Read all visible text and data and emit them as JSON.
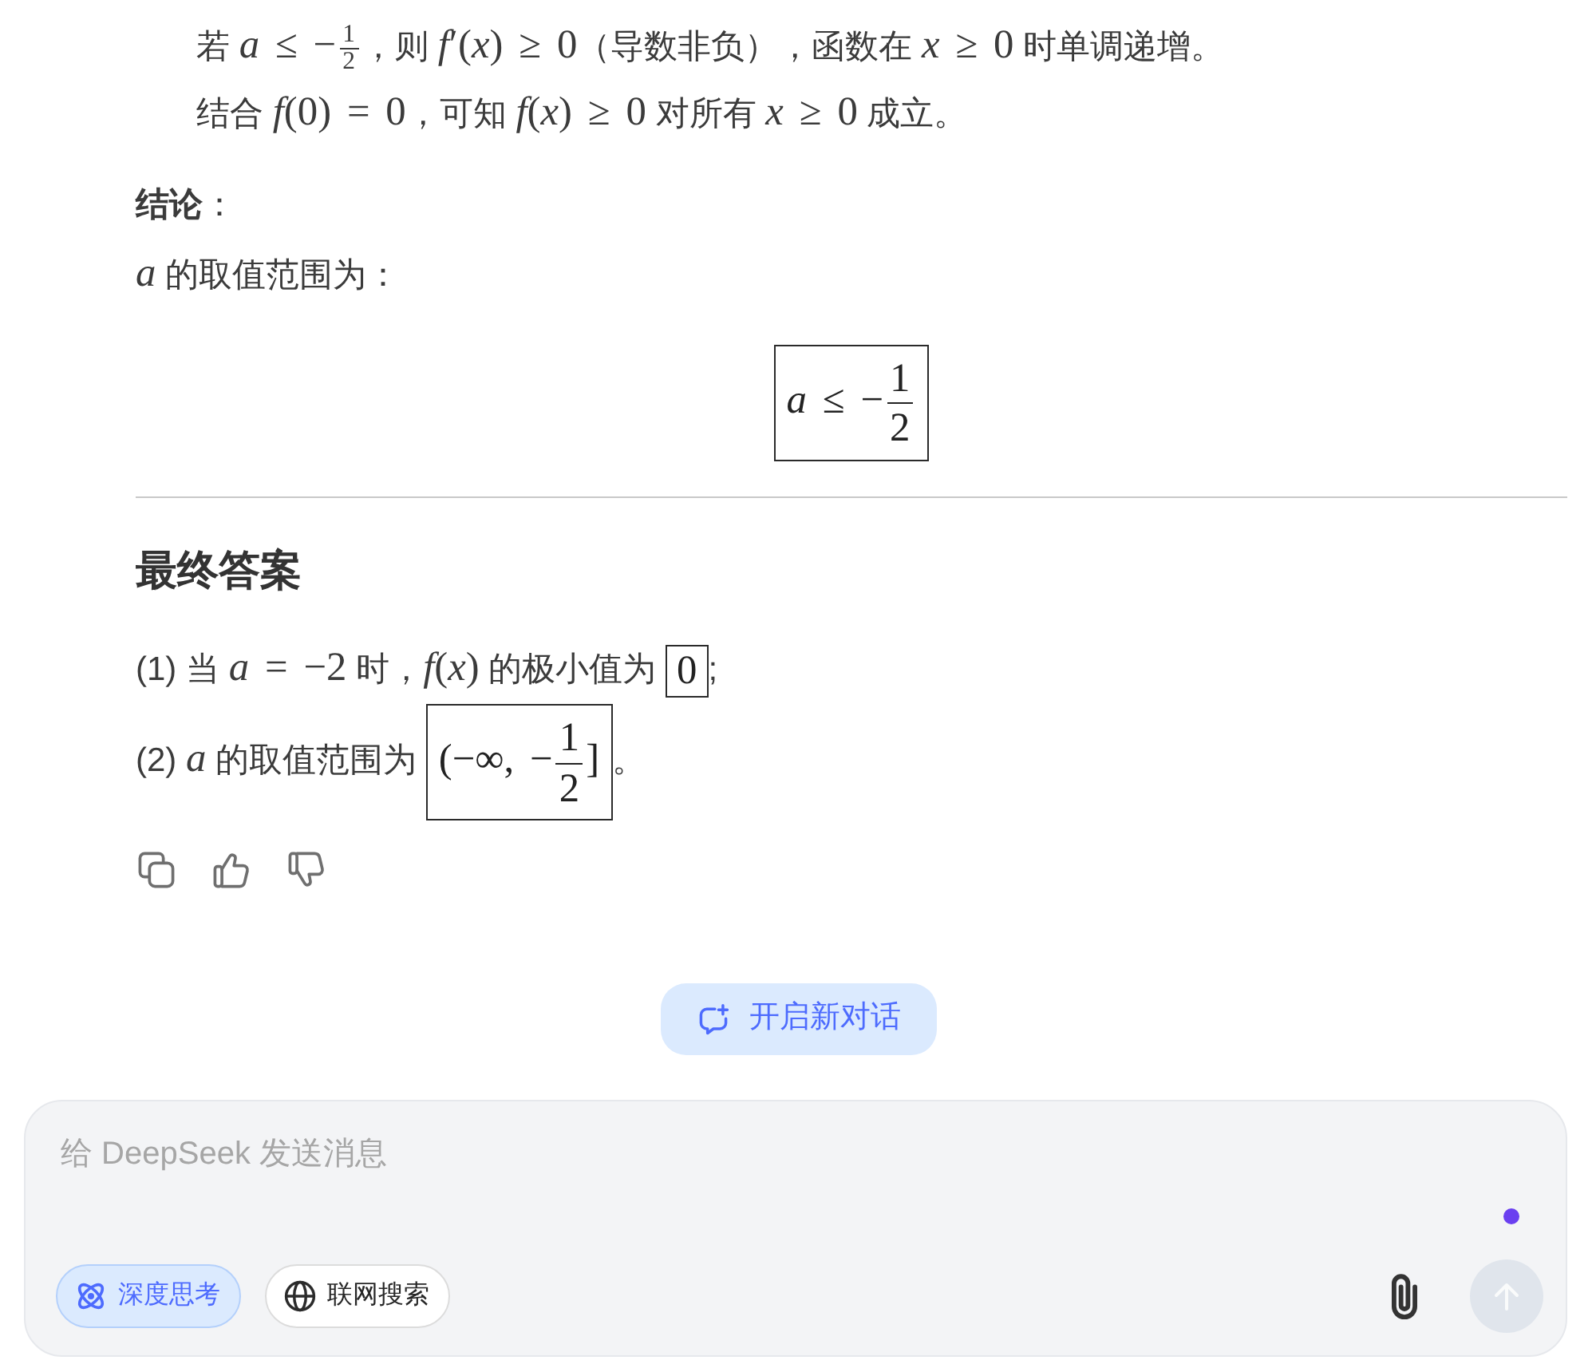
{
  "answer": {
    "steps": [
      {
        "parts": [
          {
            "kind": "text",
            "text": "若 "
          },
          {
            "kind": "math",
            "text": "*a* ≤ −"
          },
          {
            "kind": "frac",
            "num": "1",
            "den": "2"
          },
          {
            "kind": "text",
            "text": "，则 "
          },
          {
            "kind": "math",
            "text": "*f*′(*x*) ≥ 0"
          },
          {
            "kind": "text",
            "text": "（导数非负），函数在 "
          },
          {
            "kind": "math",
            "text": "*x* ≥ 0"
          },
          {
            "kind": "text",
            "text": " 时单调递增。"
          }
        ]
      },
      {
        "parts": [
          {
            "kind": "text",
            "text": "结合 "
          },
          {
            "kind": "math",
            "text": "*f*(0) = 0"
          },
          {
            "kind": "text",
            "text": "，可知 "
          },
          {
            "kind": "math",
            "text": "*f*(*x*) ≥ 0"
          },
          {
            "kind": "text",
            "text": " 对所有 "
          },
          {
            "kind": "math",
            "text": "*x* ≥ 0"
          },
          {
            "kind": "text",
            "text": " 成立。"
          }
        ]
      }
    ],
    "conclusion": {
      "heading": "**结论**：",
      "intro": {
        "parts": [
          {
            "kind": "math",
            "text": "*a*"
          },
          {
            "kind": "text",
            "text": " 的取值范围为："
          }
        ]
      },
      "result": {
        "parts": [
          {
            "kind": "boxed",
            "parts": [
              {
                "kind": "math",
                "text": "*a* ≤ −"
              },
              {
                "kind": "dfrac",
                "num": "1",
                "den": "2"
              }
            ]
          }
        ]
      }
    },
    "final_answer": {
      "heading": "最终答案",
      "items": [
        {
          "parts": [
            {
              "kind": "text",
              "text": "(1) 当 "
            },
            {
              "kind": "math",
              "text": "*a* = −2"
            },
            {
              "kind": "text",
              "text": " 时，"
            },
            {
              "kind": "math",
              "text": "*f*(*x*)"
            },
            {
              "kind": "text",
              "text": " 的极小值为 "
            },
            {
              "kind": "boxed",
              "parts": [
                {
                  "kind": "math",
                  "text": "0"
                }
              ]
            },
            {
              "kind": "text",
              "text": ";"
            }
          ]
        },
        {
          "parts": [
            {
              "kind": "text",
              "text": "(2) "
            },
            {
              "kind": "math",
              "text": "*a*"
            },
            {
              "kind": "text",
              "text": " 的取值范围为 "
            },
            {
              "kind": "boxed",
              "parts": [
                {
                  "kind": "math",
                  "text": "(−∞, −"
                },
                {
                  "kind": "dfrac",
                  "num": "1",
                  "den": "2"
                },
                {
                  "kind": "math",
                  "text": "]"
                }
              ]
            },
            {
              "kind": "text",
              "text": "。"
            }
          ]
        }
      ]
    }
  },
  "new_chat_button": {
    "label": "开启新对话"
  },
  "composer": {
    "placeholder": "给 DeepSeek 发送消息",
    "toggles": [
      {
        "kind": "think",
        "label": "深度思考",
        "selected": true
      },
      {
        "kind": "search",
        "label": "联网搜索",
        "selected": false
      }
    ],
    "send_button": {
      "disabled": true
    }
  }
}
